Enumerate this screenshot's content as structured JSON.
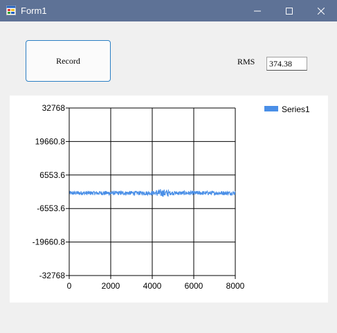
{
  "window": {
    "title": "Form1"
  },
  "toolbar": {
    "record_label": "Record",
    "rms_label": "RMS",
    "rms_value": "374.38"
  },
  "colors": {
    "titlebar": "#5e7296",
    "series": "#4a8fe7",
    "button_border": "#2a7fc4"
  },
  "chart_data": {
    "type": "line",
    "title": "",
    "xlabel": "",
    "ylabel": "",
    "xlim": [
      0,
      8000
    ],
    "ylim": [
      -32768,
      32768
    ],
    "grid": true,
    "legend_position": "top-right",
    "x_ticks": [
      "0",
      "2000",
      "4000",
      "6000",
      "8000"
    ],
    "y_ticks": [
      "32768",
      "19660.8",
      "6553.6",
      "-6553.6",
      "-19660.8",
      "-32768"
    ],
    "series": [
      {
        "name": "Series1",
        "color": "#4a8fe7",
        "sample_count": 8000,
        "baseline": -500,
        "noise_amplitude": 374.38
      }
    ]
  }
}
